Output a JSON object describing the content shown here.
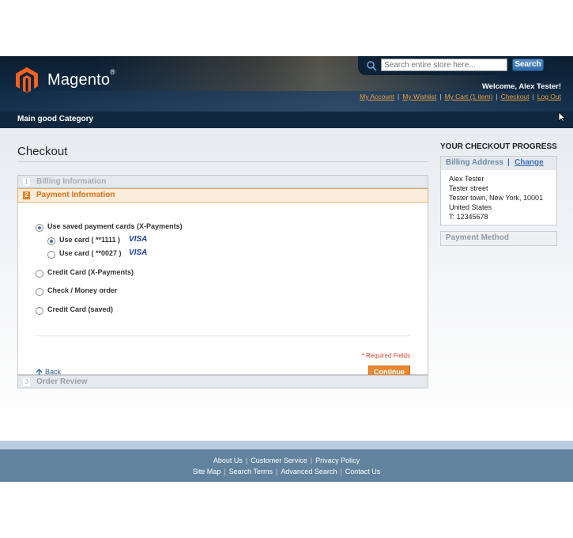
{
  "header": {
    "logo_text": "Magento",
    "logo_reg": "®",
    "search_placeholder": "Search entire store here...",
    "search_button": "Search",
    "welcome": "Welcome, Alex Tester!",
    "links": [
      "My Account",
      "My Wishlist",
      "My Cart (1 item)",
      "Checkout",
      "Log Out"
    ]
  },
  "nav": {
    "category": "Main good Category"
  },
  "checkout": {
    "title": "Checkout",
    "steps": [
      {
        "num": "1",
        "label": "Billing Information"
      },
      {
        "num": "2",
        "label": "Payment Information"
      },
      {
        "num": "3",
        "label": "Order Review"
      }
    ],
    "payment_options": {
      "saved_cards": "Use saved payment cards (X-Payments)",
      "card1": "Use card ( **1111 )",
      "card2": "Use card ( **0027 )",
      "card_brand": "VISA",
      "credit_card": "Credit Card (X-Payments)",
      "check": "Check / Money order",
      "credit_card_saved": "Credit Card (saved)"
    },
    "required_fields": "* Required Fields",
    "back": "Back",
    "continue": "Continue"
  },
  "sidebar": {
    "title": "YOUR CHECKOUT PROGRESS",
    "billing_label": "Billing Address",
    "separator": "|",
    "change": "Change",
    "address": [
      "Alex Tester",
      "Tester street",
      "Tester town, New York, 10001",
      "United States",
      "T: 12345678"
    ],
    "payment_method": "Payment Method"
  },
  "footer": {
    "row1": [
      "About Us",
      "Customer Service",
      "Privacy Policy"
    ],
    "row2": [
      "Site Map",
      "Search Terms",
      "Advanced Search",
      "Contact Us"
    ]
  },
  "colors": {
    "header_bg": "#0b1d30",
    "accent_orange": "#e88831",
    "link_blue": "#3f6fb8",
    "footer_bg": "#62839f"
  }
}
